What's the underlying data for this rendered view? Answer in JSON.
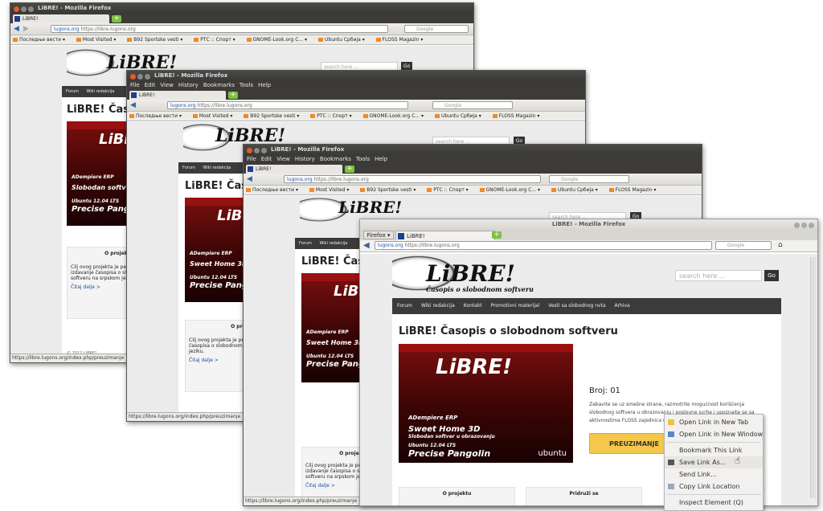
{
  "background_title": "...",
  "common": {
    "tab_label": "LiBRE!",
    "url_host": "lugons.org",
    "url_full": "https://libre.lugons.org",
    "search_placeholder": "Google",
    "site_search_placeholder": "search here ...",
    "go_label": "Go",
    "site_logo": "LiBRE!",
    "site_tagline": "Časopis o slobodnom softveru",
    "page_heading": "LiBRE! Časopis o slobodnom softveru",
    "status_url": "https://libre.lugons.org/index.php/preuzimanje"
  },
  "menus": [
    "File",
    "Edit",
    "View",
    "History",
    "Bookmarks",
    "Tools",
    "Help"
  ],
  "bookmarks": [
    "Последње вести ▾",
    "Most Visited ▾",
    "B92 Sportske vesti ▾",
    "РТС :: Спорт ▾",
    "GNOME-Look.org C... ▾",
    "Ubuntu Србија ▾",
    "FLOSS Magazin ▾"
  ],
  "site_nav": [
    "Forum",
    "Wiki redakcija",
    "Kontakt",
    "Promotivni materijal",
    "Vesti sa slobodnog nvta",
    "Arhiva"
  ],
  "windows": [
    {
      "title": "LiBRE! - Mozilla Firefox",
      "has_menubar": false
    },
    {
      "title": "LiBRE! - Mozilla Firefox",
      "has_menubar": true
    },
    {
      "title": "LiBRE! - Mozilla Firefox",
      "has_menubar": true
    },
    {
      "title": "LiBRE! - Mozilla Firefox",
      "has_menubar": false,
      "firefox_button": "Firefox ▾"
    }
  ],
  "magazine": {
    "masthead": "LiBRE!",
    "items": [
      "ADempiere ERP",
      "Sweet Home 3D",
      "Slobodan softver u obrazovanju",
      "Ubuntu 12.04 LTS",
      "Precise Pangolin"
    ],
    "brand": "ubuntu"
  },
  "issue": {
    "number_label": "Broj: 01",
    "description": "Zabavite se uz smešne strane, razmotrite mogućnost korišćenja slobodnog softvera u obrazovanju i poslovne svrhe i upoznajte se sa aktivnostima FLOSS zajednica u proteklom periodu.",
    "download_label": "PREUZIMANJE"
  },
  "boxes": {
    "about_title": "O projektu",
    "about_text": "Cilj ovog projekta je periodično izdavanje časopisa o slobodnom softveru na srpskom jeziku.",
    "read_more": "Čitaj dalje >",
    "join_title": "Pridruži se",
    "footer": "© 2012 LiBRE!"
  },
  "context_menu": {
    "items": [
      {
        "label": "Open Link in New Tab",
        "icon": "tab-icon"
      },
      {
        "label": "Open Link in New Window",
        "icon": "window-icon"
      },
      {
        "separator": true
      },
      {
        "label": "Bookmark This Link",
        "icon": ""
      },
      {
        "label": "Save Link As...",
        "icon": "save-icon",
        "hover": true
      },
      {
        "label": "Send Link...",
        "icon": ""
      },
      {
        "label": "Copy Link Location",
        "icon": "copy-icon"
      },
      {
        "separator": true
      },
      {
        "label": "Inspect Element (Q)",
        "icon": ""
      }
    ]
  },
  "colors": {
    "title_dark": "#3c3b37",
    "close_orange": "#e25a2a",
    "site_nav": "#3b3b3b",
    "download_button": "#f5c74a",
    "magazine_red": "#7a0f0f"
  }
}
